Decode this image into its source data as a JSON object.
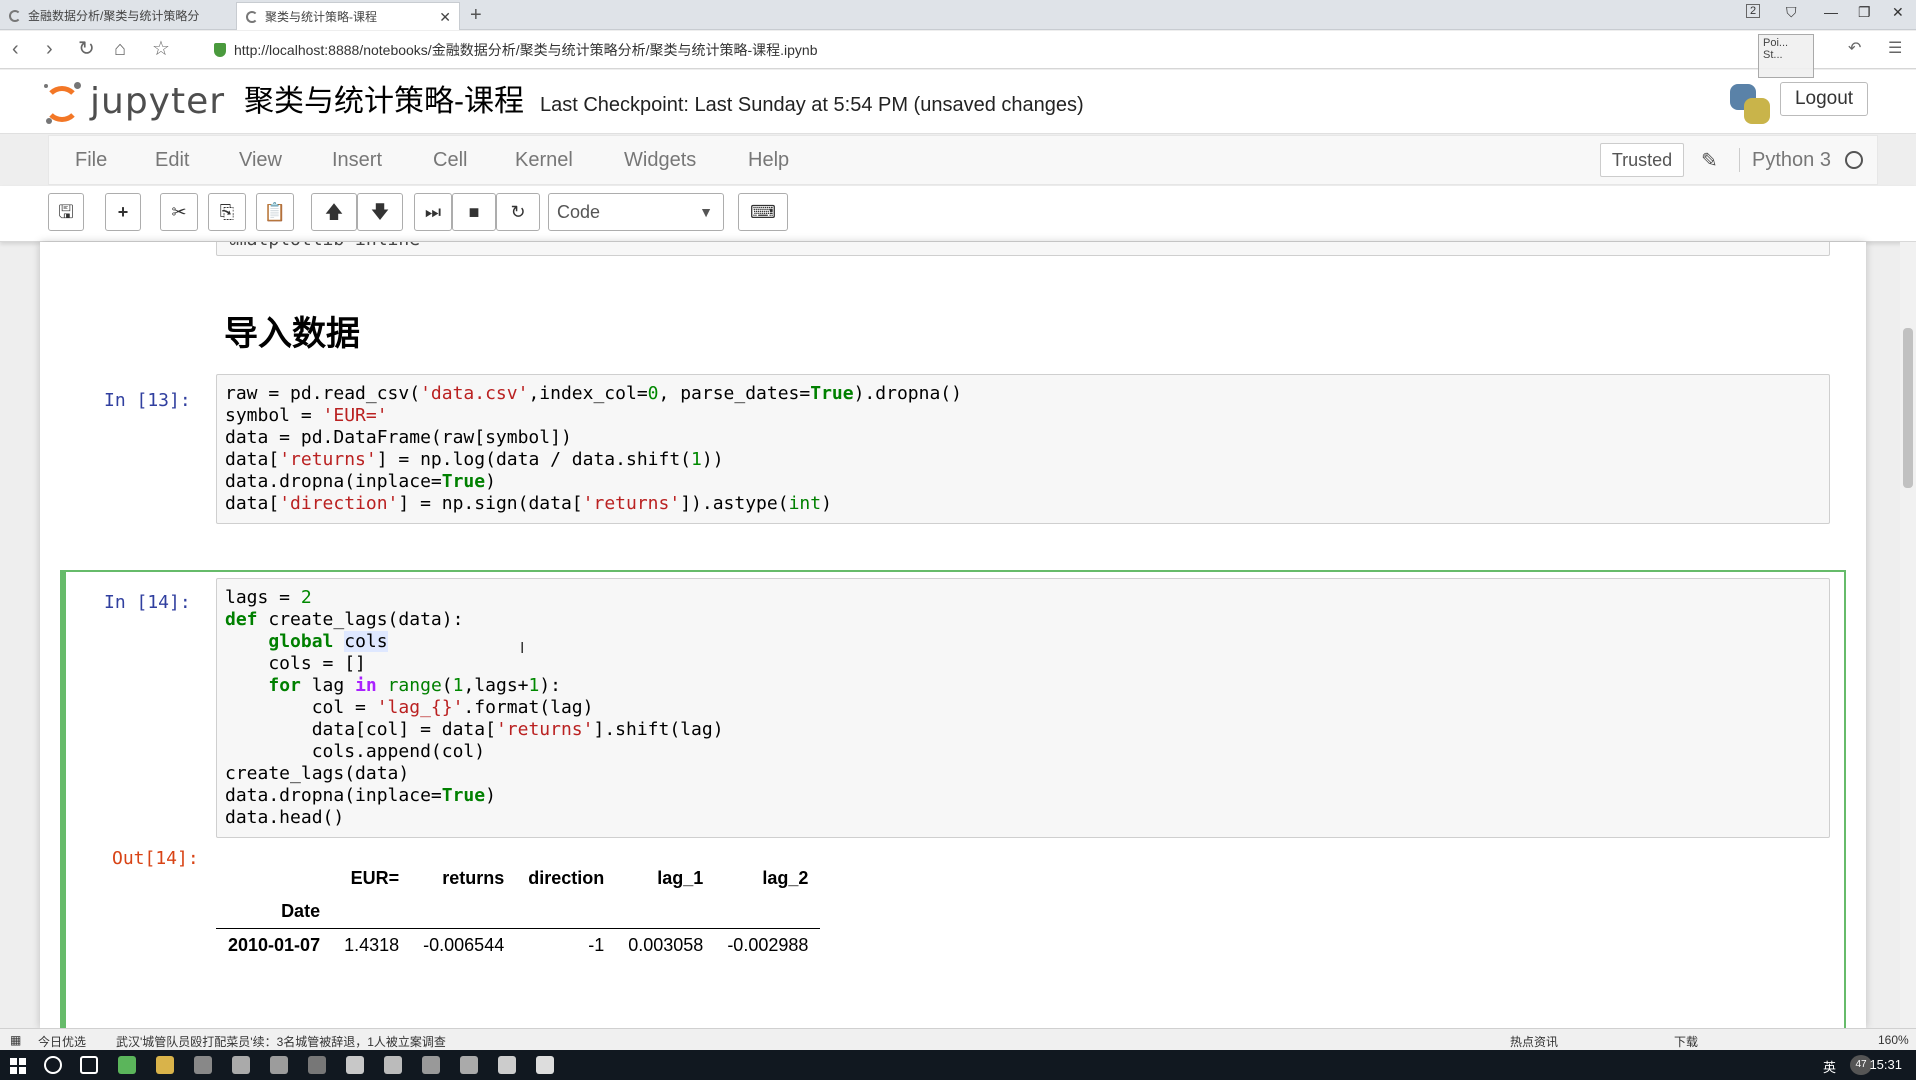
{
  "browser": {
    "tabs": [
      {
        "label": "金融数据分析/聚类与统计策略分"
      },
      {
        "label": "聚类与统计策略-课程"
      }
    ],
    "url": "http://localhost:8888/notebooks/金融数据分析/聚类与统计策略分析/聚类与统计策略-课程.ipynb",
    "tab_count_badge": "2",
    "overlay_text": "Poi... St..."
  },
  "header": {
    "logo_text": "jupyter",
    "notebook_title": "聚类与统计策略-课程",
    "checkpoint": "Last Checkpoint: Last Sunday at 5:54 PM (unsaved changes)",
    "logout_label": "Logout"
  },
  "menubar": {
    "items": [
      "File",
      "Edit",
      "View",
      "Insert",
      "Cell",
      "Kernel",
      "Widgets",
      "Help"
    ],
    "trusted_label": "Trusted",
    "kernel_name": "Python 3"
  },
  "toolbar": {
    "cell_type": "Code",
    "icons": [
      "save-icon",
      "add-cell-icon",
      "cut-icon",
      "copy-icon",
      "paste-icon",
      "move-up-icon",
      "move-down-icon",
      "run-icon",
      "stop-icon",
      "restart-icon",
      "keyboard-icon"
    ]
  },
  "notebook": {
    "prev_cell_code": "%matplotlib inline",
    "heading": "导入数据",
    "cell13": {
      "prompt": "In  [13]:",
      "lines": [
        "raw = pd.read_csv('data.csv',index_col=0, parse_dates=True).dropna()",
        "symbol = 'EUR='",
        "data = pd.DataFrame(raw[symbol])",
        "data['returns'] = np.log(data / data.shift(1))",
        "data.dropna(inplace=True)",
        "data['direction'] = np.sign(data['returns']).astype(int)"
      ]
    },
    "cell14": {
      "prompt": "In  [14]:",
      "out_prompt": "Out[14]:",
      "lines": [
        "lags = 2",
        "def create_lags(data):",
        "    global cols",
        "    cols = []",
        "    for lag in range(1,lags+1):",
        "        col = 'lag_{}'.format(lag)",
        "        data[col] = data['returns'].shift(lag)",
        "        cols.append(col)",
        "create_lags(data)",
        "data.dropna(inplace=True)",
        "data.head()"
      ]
    },
    "output_table": {
      "columns": [
        "EUR=",
        "returns",
        "direction",
        "lag_1",
        "lag_2"
      ],
      "index_name": "Date",
      "rows": [
        [
          "2010-01-07",
          "1.4318",
          "-0.006544",
          "-1",
          "0.003058",
          "-0.002988"
        ]
      ]
    }
  },
  "statusbar": {
    "left_label": "今日优选",
    "news": "武汉'城管队员殴打配菜员'续：3名城管被辞退，1人被立案调查",
    "right_items": [
      "热点资讯",
      "下载"
    ],
    "zoom": "160%"
  },
  "taskbar": {
    "lang": "英",
    "time": "15:31",
    "badge": "47"
  }
}
